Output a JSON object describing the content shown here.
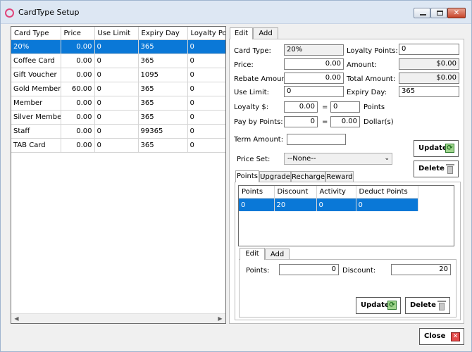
{
  "window": {
    "title": "CardType Setup"
  },
  "grid": {
    "columns": [
      "Card Type",
      "Price",
      "Use Limit",
      "Expiry Day",
      "Loyalty Points"
    ],
    "rows": [
      {
        "card_type": "20%",
        "price": "0.00",
        "use_limit": "0",
        "expiry_day": "365",
        "loyalty": "0",
        "selected": true
      },
      {
        "card_type": "Coffee Card",
        "price": "0.00",
        "use_limit": "0",
        "expiry_day": "365",
        "loyalty": "0"
      },
      {
        "card_type": "Gift Voucher",
        "price": "0.00",
        "use_limit": "0",
        "expiry_day": "1095",
        "loyalty": "0"
      },
      {
        "card_type": "Gold Member",
        "price": "60.00",
        "use_limit": "0",
        "expiry_day": "365",
        "loyalty": "0"
      },
      {
        "card_type": "Member",
        "price": "0.00",
        "use_limit": "0",
        "expiry_day": "365",
        "loyalty": "0"
      },
      {
        "card_type": "Silver Member",
        "price": "0.00",
        "use_limit": "0",
        "expiry_day": "365",
        "loyalty": "0"
      },
      {
        "card_type": "Staff",
        "price": "0.00",
        "use_limit": "0",
        "expiry_day": "99365",
        "loyalty": "0"
      },
      {
        "card_type": "TAB Card",
        "price": "0.00",
        "use_limit": "0",
        "expiry_day": "365",
        "loyalty": "0"
      }
    ]
  },
  "tabs": {
    "edit": "Edit",
    "add": "Add"
  },
  "form": {
    "card_type_label": "Card Type:",
    "card_type_value": "20%",
    "price_label": "Price:",
    "price_value": "0.00",
    "rebate_label": "Rebate Amount:",
    "rebate_value": "0.00",
    "use_limit_label": "Use Limit:",
    "use_limit_value": "0",
    "loyalty_dollar_label": "Loyalty $:",
    "loyalty_dollar_value": "0.00",
    "equals": "=",
    "loyalty_points_value": "0",
    "points_unit": "Points",
    "pay_by_points_label": "Pay by Points:",
    "pay_points_value": "0",
    "pay_dollar_value": "0.00",
    "dollars_unit": "Dollar(s)",
    "term_amount_label": "Term Amount:",
    "term_amount_value": "",
    "price_set_label": "Price Set:",
    "price_set_value": "--None--",
    "loyalty_points_label": "Loyalty Points:",
    "loyalty_points_right": "0",
    "amount_label": "Amount:",
    "amount_value": "$0.00",
    "total_amount_label": "Total Amount:",
    "total_amount_value": "$0.00",
    "expiry_day_label": "Expiry Day:",
    "expiry_day_value": "365"
  },
  "buttons": {
    "update": "Update",
    "delete": "Delete",
    "close": "Close"
  },
  "subtabs": [
    "Points",
    "Upgrade",
    "Recharge",
    "Reward"
  ],
  "points_table": {
    "columns": [
      "Points",
      "Discount",
      "Activity",
      "Deduct Points"
    ],
    "rows": [
      {
        "points": "0",
        "discount": "20",
        "activity": "0",
        "deduct": "0",
        "selected": true
      }
    ]
  },
  "sub_edit": {
    "tab_edit": "Edit",
    "tab_add": "Add",
    "points_label": "Points:",
    "points_value": "0",
    "discount_label": "Discount:",
    "discount_value": "20"
  },
  "colors": {
    "selection": "#0a78d7",
    "titlebar": "#dde7f3",
    "window_bg": "#f0f0f0"
  }
}
